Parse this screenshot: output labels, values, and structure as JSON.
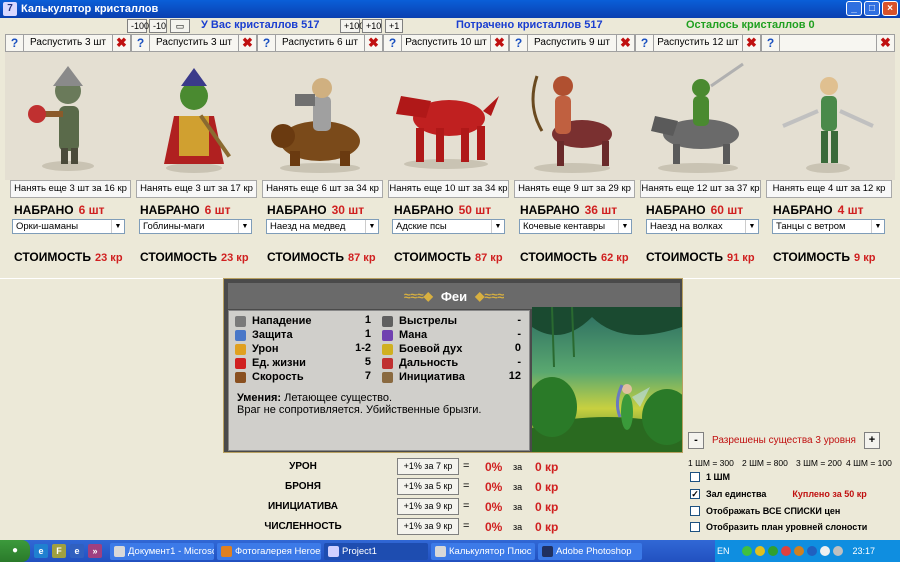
{
  "window": {
    "title": "Калькулятор кристаллов",
    "icon": "crystal-app-icon"
  },
  "top": {
    "minus_buttons": [
      "-100",
      "-10"
    ],
    "have_label": "У Вас кристаллов 517",
    "plus_buttons": [
      "+100",
      "+10",
      "+1"
    ],
    "spent_label": "Потрачено кристаллов 517",
    "left_label": "Осталось кристаллов 0"
  },
  "units": [
    {
      "release": "Распустить 3 шт",
      "hire": "Нанять еще 3 шт за 16 кр",
      "gathered_label": "НАБРАНО",
      "gathered": "6 шт",
      "select": "Орки-шаманы",
      "cost_label": "СТОИМОСТЬ",
      "cost": "23 кр",
      "pic": "orc-shaman"
    },
    {
      "release": "Распустить 3 шт",
      "hire": "Нанять еще 3 шт за 17 кр",
      "gathered_label": "НАБРАНО",
      "gathered": "6 шт",
      "select": "Гоблины-маги",
      "cost_label": "СТОИМОСТЬ",
      "cost": "23 кр",
      "pic": "goblin-mage"
    },
    {
      "release": "Распустить 6 шт",
      "hire": "Нанять еще 6 шт за 34 кр",
      "gathered_label": "НАБРАНО",
      "gathered": "30 шт",
      "select": "Наезд на медвед",
      "cost_label": "СТОИМОСТЬ",
      "cost": "87 кр",
      "pic": "bear-rider"
    },
    {
      "release": "Распустить 10 шт",
      "hire": "Нанять еще 10 шт за 34 кр",
      "gathered_label": "НАБРАНО",
      "gathered": "50 шт",
      "select": "Адские псы",
      "cost_label": "СТОИМОСТЬ",
      "cost": "87 кр",
      "pic": "hell-hound"
    },
    {
      "release": "Распустить 9 шт",
      "hire": "Нанять еще 9 шт за 29 кр",
      "gathered_label": "НАБРАНО",
      "gathered": "36 шт",
      "select": "Кочевые кентавры",
      "cost_label": "СТОИМОСТЬ",
      "cost": "62 кр",
      "pic": "centaur"
    },
    {
      "release": "Распустить 12 шт",
      "hire": "Нанять еще 12 шт за 37 кр",
      "gathered_label": "НАБРАНО",
      "gathered": "60 шт",
      "select": "Наезд на волках",
      "cost_label": "СТОИМОСТЬ",
      "cost": "91 кр",
      "pic": "wolf-rider"
    },
    {
      "release": "",
      "hire": "Нанять еще 4 шт за 12 кр",
      "gathered_label": "НАБРАНО",
      "gathered": "4 шт",
      "select": "Танцы с ветром",
      "cost_label": "СТОИМОСТЬ",
      "cost": "9 кр",
      "pic": "wind-dancer"
    }
  ],
  "card": {
    "title": "Феи",
    "left_stats": [
      {
        "label": "Нападение",
        "value": "1",
        "icon": "sword-icon",
        "color": "#7a7a7a"
      },
      {
        "label": "Защита",
        "value": "1",
        "icon": "shield-icon",
        "color": "#4a78c8"
      },
      {
        "label": "Урон",
        "value": "1-2",
        "icon": "damage-icon",
        "color": "#e0a020"
      },
      {
        "label": "Ед. жизни",
        "value": "5",
        "icon": "heart-icon",
        "color": "#d02020"
      },
      {
        "label": "Скорость",
        "value": "7",
        "icon": "boot-icon",
        "color": "#8a5020"
      }
    ],
    "right_stats": [
      {
        "label": "Выстрелы",
        "value": "-",
        "icon": "arrow-icon",
        "color": "#606060"
      },
      {
        "label": "Мана",
        "value": "-",
        "icon": "mana-icon",
        "color": "#7040b0"
      },
      {
        "label": "Боевой дух",
        "value": "0",
        "icon": "morale-icon",
        "color": "#d0b020"
      },
      {
        "label": "Дальность",
        "value": "-",
        "icon": "target-icon",
        "color": "#c03030"
      },
      {
        "label": "Инициатива",
        "value": "12",
        "icon": "hourglass-icon",
        "color": "#8a6a40"
      }
    ],
    "skills_label": "Умения:",
    "skills_text": "Летающее существо.",
    "skills_text2": "Враг не сопротивляется.  Убийственные брызги."
  },
  "upgrades": [
    {
      "name": "УРОН",
      "button": "+1% за 7 кр",
      "eq": "=",
      "percent": "0%",
      "za": "за",
      "kr": "0 кр"
    },
    {
      "name": "БРОНЯ",
      "button": "+1% за 5 кр",
      "eq": "=",
      "percent": "0%",
      "za": "за",
      "kr": "0 кр"
    },
    {
      "name": "ИНИЦИАТИВА",
      "button": "+1% за 9 кр",
      "eq": "=",
      "percent": "0%",
      "za": "за",
      "kr": "0 кр"
    },
    {
      "name": "ЧИСЛЕННОСТЬ",
      "button": "+1% за 9 кр",
      "eq": "=",
      "percent": "0%",
      "za": "за",
      "kr": "0 кр"
    }
  ],
  "levels": {
    "minus": "-",
    "plus": "+",
    "label": "Разрешены существа 3 уровня"
  },
  "shm": [
    "1 ШМ = 300",
    "2 ШМ = 800",
    "3 ШМ = 200",
    "4 ШМ = 100"
  ],
  "checks": [
    {
      "label": "1 ШМ",
      "checked": false,
      "extra": ""
    },
    {
      "label": "Зал единства",
      "checked": true,
      "extra": "Куплено за 50 кр"
    },
    {
      "label": "Отображать ВСЕ СПИСКИ цен",
      "checked": false,
      "extra": ""
    },
    {
      "label": "Отобразить план уровней слоности",
      "checked": false,
      "extra": ""
    }
  ],
  "taskbar": {
    "tasks": [
      "Документ1 - Microso...",
      "Фотогалерея Heroes...",
      "Project1",
      "Калькулятор Плюс",
      "Adobe Photoshop"
    ],
    "active": 2,
    "lang": "EN",
    "clock": "23:17"
  }
}
